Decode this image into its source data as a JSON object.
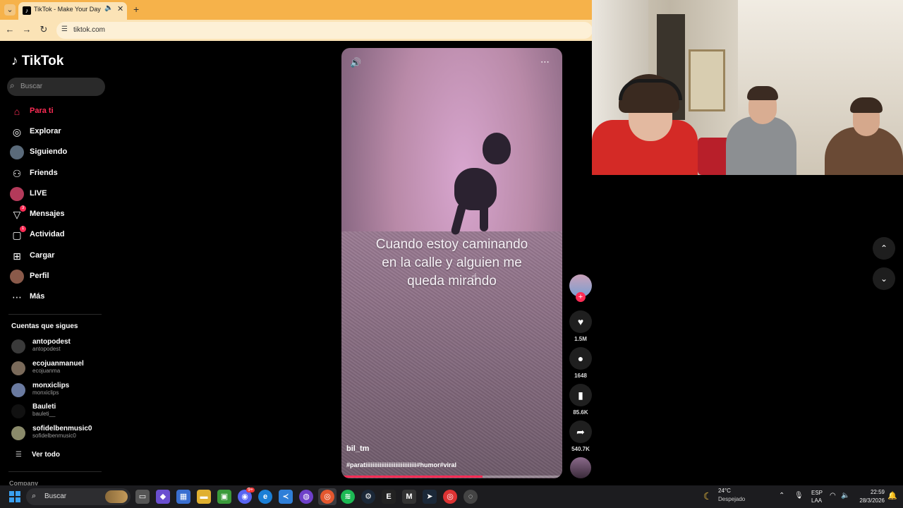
{
  "browser": {
    "tab_title": "TikTok - Make Your Day",
    "url": "tiktok.com",
    "icons": [
      "tab-dropdown-icon",
      "tiktok-favicon",
      "speaker-icon",
      "close-icon",
      "plus-icon",
      "back-icon",
      "forward-icon",
      "reload-icon",
      "site-info-icon"
    ]
  },
  "sidebar": {
    "logo": "TikTok",
    "search_placeholder": "Buscar",
    "items": [
      {
        "label": "Para ti",
        "icon": "home-icon",
        "active": true
      },
      {
        "label": "Explorar",
        "icon": "compass-icon"
      },
      {
        "label": "Siguiendo",
        "icon": "following-avatar-icon"
      },
      {
        "label": "Friends",
        "icon": "friends-icon"
      },
      {
        "label": "LIVE",
        "icon": "live-icon"
      },
      {
        "label": "Mensajes",
        "icon": "send-icon",
        "badge": "3"
      },
      {
        "label": "Actividad",
        "icon": "activity-icon",
        "badge": "1"
      },
      {
        "label": "Cargar",
        "icon": "upload-icon"
      },
      {
        "label": "Perfil",
        "icon": "profile-avatar-icon"
      },
      {
        "label": "Más",
        "icon": "more-icon"
      }
    ],
    "following_title": "Cuentas que sigues",
    "following": [
      {
        "name": "antopodest",
        "handle": "antopodest"
      },
      {
        "name": "ecojuanmanuel",
        "handle": "ecojuanma"
      },
      {
        "name": "monxiclips",
        "handle": "monxiclips"
      },
      {
        "name": "Bauleti",
        "handle": "bauleti__"
      },
      {
        "name": "sofidelbenmusic0",
        "handle": "sofidelbenmusic0"
      }
    ],
    "see_all": "Ver todo",
    "footer_section": "Company"
  },
  "video": {
    "caption_lines": [
      "Cuando estoy caminando",
      "en la calle y alguien me",
      "queda mirando"
    ],
    "author": "bil_tm",
    "tags": "#paratiiiiiiiiiiiiiiiiiiiiiiiiiiiii#humor#viral",
    "progress": 0.64
  },
  "actions": {
    "likes": "1.5M",
    "comments": "1648",
    "saves": "85.6K",
    "shares": "540.7K"
  },
  "taskbar": {
    "search_label": "Buscar",
    "weather_temp": "24°C",
    "weather_condition": "Despejado",
    "lang_line1": "ESP",
    "lang_line2": "LAA",
    "time": "22:59",
    "date": "28/3/2026",
    "messenger_badge": "9+"
  },
  "colors": {
    "accent": "#fe2c55",
    "chrome": "#f6b24a"
  }
}
